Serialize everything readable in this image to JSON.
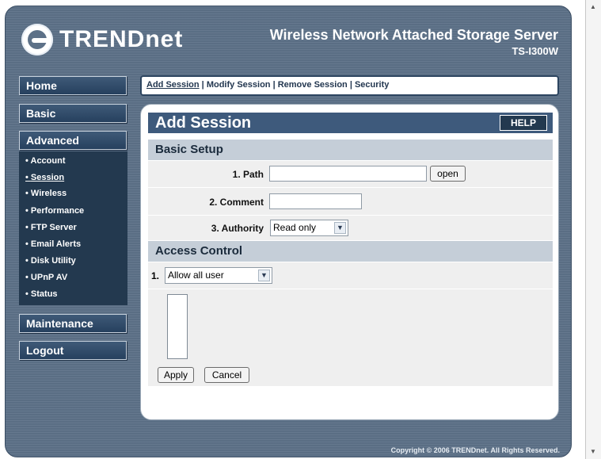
{
  "brand": {
    "logo": "TRENDnet",
    "product_title": "Wireless Network Attached Storage Server",
    "model": "TS-I300W"
  },
  "nav": {
    "home": "Home",
    "basic": "Basic",
    "advanced": "Advanced",
    "maintenance": "Maintenance",
    "logout": "Logout",
    "sub_items": [
      "Account",
      "Session",
      "Wireless",
      "Performance",
      "FTP Server",
      "Email Alerts",
      "Disk Utility",
      "UPnP AV",
      "Status"
    ],
    "active_sub": "Session"
  },
  "subnav": {
    "items": [
      "Add Session",
      "Modify Session",
      "Remove Session",
      "Security"
    ]
  },
  "panel": {
    "title": "Add Session",
    "help": "HELP",
    "basic_setup": "Basic Setup",
    "path_label": "1. Path",
    "open_button": "open",
    "comment_label": "2. Comment",
    "authority_label": "3. Authority",
    "authority_value": "Read only",
    "access_control": "Access Control",
    "access_index": "1.",
    "access_value": "Allow all user",
    "apply": "Apply",
    "cancel": "Cancel"
  },
  "footer": {
    "copyright": "Copyright © 2006 TRENDnet. All Rights Reserved."
  },
  "icons": {
    "dropdown": "chevron-down-icon",
    "scroll_up": "scroll-up-icon",
    "scroll_down": "scroll-down-icon"
  },
  "colors": {
    "frame": "#5d7188",
    "nav_button": "#2d4663",
    "submenu": "#23394f",
    "title_bar": "#3e5a7c",
    "section_header": "#c5ced8"
  }
}
